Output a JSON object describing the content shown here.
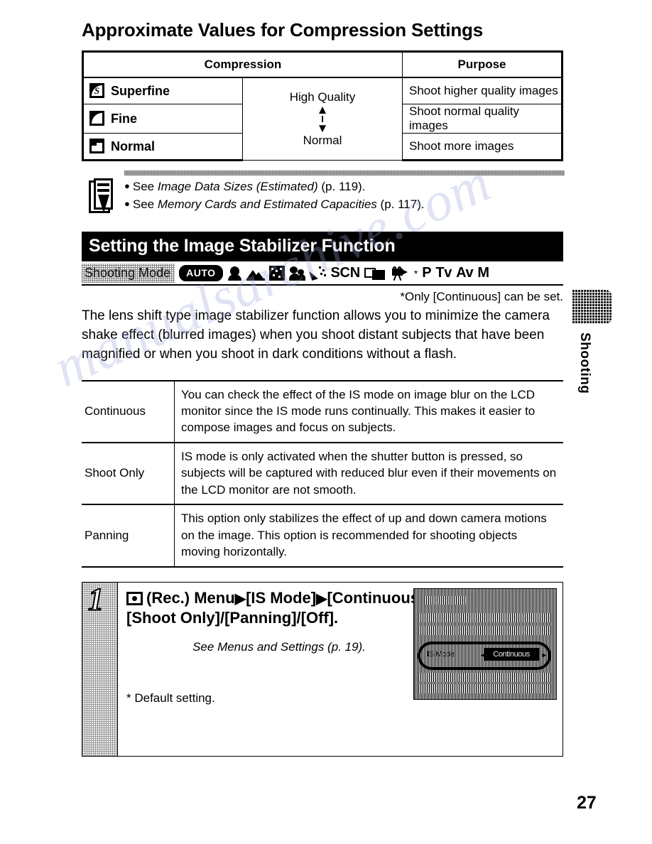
{
  "page": {
    "title": "Approximate Values for Compression Settings",
    "number": "27",
    "side_tab_label": "Shooting",
    "watermark": "manualsarchive.com"
  },
  "compression_table": {
    "headers": {
      "compression": "Compression",
      "purpose": "Purpose"
    },
    "quality_scale": {
      "top": "High Quality",
      "bottom": "Normal"
    },
    "rows": [
      {
        "icon": "superfine-quality-icon",
        "mode": "Superfine",
        "purpose": "Shoot higher quality images"
      },
      {
        "icon": "fine-quality-icon",
        "mode": "Fine",
        "purpose": "Shoot normal quality images"
      },
      {
        "icon": "normal-quality-icon",
        "mode": "Normal",
        "purpose": "Shoot more images"
      }
    ]
  },
  "notes": {
    "icon": "memo-pencil-icon",
    "items": [
      {
        "prefix": "See ",
        "italic": "Image Data Sizes (Estimated)",
        "suffix": " (p. 119)."
      },
      {
        "prefix": "See ",
        "italic": "Memory Cards and Estimated Capacities",
        "suffix": " (p. 117)."
      }
    ]
  },
  "section": {
    "title": "Setting the Image Stabilizer Function",
    "shooting_mode_label": "Shooting Mode",
    "shooting_modes": [
      {
        "name": "auto-mode-icon",
        "label": "AUTO"
      },
      {
        "name": "portrait-mode-icon",
        "label": ""
      },
      {
        "name": "landscape-mode-icon",
        "label": ""
      },
      {
        "name": "night-scene-mode-icon",
        "label": ""
      },
      {
        "name": "kids-and-pets-mode-icon",
        "label": ""
      },
      {
        "name": "indoor-party-mode-icon",
        "label": ""
      },
      {
        "name": "scn-mode-icon",
        "label": "SCN"
      },
      {
        "name": "stitch-assist-mode-icon",
        "label": ""
      },
      {
        "name": "movie-mode-icon",
        "label": ""
      },
      {
        "name": "movie-mode-asterisk",
        "label": "*"
      },
      {
        "name": "program-mode-icon",
        "label": "P"
      },
      {
        "name": "tv-mode-icon",
        "label": "Tv"
      },
      {
        "name": "av-mode-icon",
        "label": "Av"
      },
      {
        "name": "manual-mode-icon",
        "label": "M"
      }
    ],
    "footnote": "*Only [Continuous] can be set.",
    "body": "The lens shift type image stabilizer function allows you to minimize the camera shake effect (blurred images) when you shoot distant subjects that have been magnified or when you shoot in dark conditions without a flash."
  },
  "is_modes": [
    {
      "name": "Continuous",
      "description": "You can check the effect of the IS mode on image blur on the LCD monitor since the IS mode runs continually. This makes it easier to compose images and focus on subjects."
    },
    {
      "name": "Shoot Only",
      "description": "IS mode is only activated when the shutter button is pressed, so subjects will be captured with reduced blur even if their movements on the LCD monitor are not smooth."
    },
    {
      "name": "Panning",
      "description": "This option only stabilizes the effect of up and down camera motions on the image. This option is recommended for shooting objects moving horizontally."
    }
  ],
  "step": {
    "number": "1",
    "rec_icon": "rec-menu-icon",
    "heading_line1_a": "(Rec.) Menu",
    "heading_line1_b": "[IS Mode]",
    "heading_line1_c": "[Continuous]*/",
    "heading_line2": "[Shoot Only]/[Panning]/[Off].",
    "see_menus": "See Menus and Settings (p. 19).",
    "default_note": "* Default setting.",
    "lcd": {
      "menu_item": "IS Mode",
      "selected_value": "Continuous",
      "arrow_left": "◄",
      "arrow_right": "►"
    }
  }
}
